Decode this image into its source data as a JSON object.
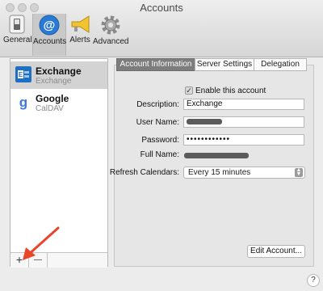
{
  "window": {
    "title": "Accounts"
  },
  "toolbar": [
    {
      "label": "General"
    },
    {
      "label": "Accounts"
    },
    {
      "label": "Alerts"
    },
    {
      "label": "Advanced"
    }
  ],
  "accounts": [
    {
      "name": "Exchange",
      "type": "Exchange",
      "selected": true,
      "badge_color": "#1f6fc1"
    },
    {
      "name": "Google",
      "type": "CalDAV",
      "selected": false,
      "badge_color": "#ffffff"
    }
  ],
  "list_controls": {
    "add": "+",
    "remove": "—"
  },
  "tabs": [
    {
      "label": "Account Information",
      "active": true
    },
    {
      "label": "Server Settings",
      "active": false
    },
    {
      "label": "Delegation",
      "active": false
    }
  ],
  "form": {
    "enable_label": "Enable this account",
    "enable_checked": true,
    "description_label": "Description:",
    "description_value": "Exchange",
    "username_label": "User Name:",
    "password_label": "Password:",
    "password_value": "••••••••••••",
    "fullname_label": "Full Name:",
    "refresh_label": "Refresh Calendars:",
    "refresh_value": "Every 15 minutes"
  },
  "buttons": {
    "edit_account": "Edit Account...",
    "help": "?"
  },
  "colors": {
    "accent": "#2a7ad5",
    "selection": "#d3d3d3",
    "annotation_arrow": "#e8452b"
  }
}
